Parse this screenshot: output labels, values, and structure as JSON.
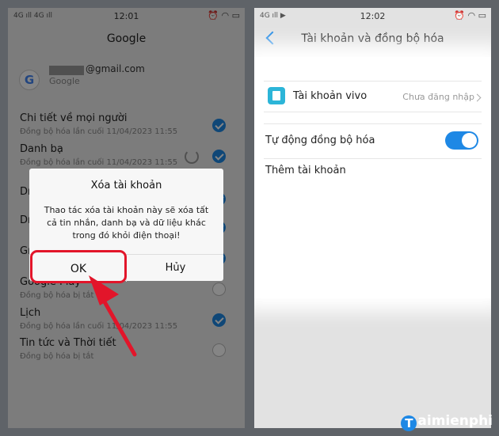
{
  "left": {
    "status": {
      "left": "4G ıll 4G ıll",
      "time": "12:01",
      "right": "⏰ ◠ ▭"
    },
    "title": "Google",
    "account": {
      "email_suffix": "@gmail.com",
      "provider": "Google"
    },
    "items": [
      {
        "title": "Chi tiết về mọi người",
        "sub": "Đồng bộ hóa lần cuối 11/04/2023 11:55",
        "checked": true
      },
      {
        "title": "Danh bạ",
        "sub": "Đồng bộ hóa lần cuối 11/04/2023 11:55",
        "checked": true
      },
      {
        "title": "Dr",
        "sub": "",
        "checked": true
      },
      {
        "title": "Dr",
        "sub": "",
        "checked": true
      },
      {
        "title": "Gr",
        "sub": "",
        "checked": true
      },
      {
        "title": "Google Play",
        "sub": "Đồng bộ hóa bị tắt",
        "checked": false
      },
      {
        "title": "Lịch",
        "sub": "Đồng bộ hóa lần cuối 11/04/2023 11:55",
        "checked": true
      },
      {
        "title": "Tin tức và Thời tiết",
        "sub": "Đồng bộ hóa bị tắt",
        "checked": false
      }
    ],
    "dialog": {
      "title": "Xóa tài khoản",
      "message": "Thao tác xóa tài khoản này sẽ xóa tất cả tin nhắn, danh bạ và dữ liệu khác trong đó khỏi điện thoại!",
      "ok": "OK",
      "cancel": "Hủy"
    }
  },
  "right": {
    "status": {
      "left": "4G ıll ▶",
      "time": "12:02",
      "right": "⏰ ◠ ▭"
    },
    "title": "Tài khoản và đồng bộ hóa",
    "vivo_label": "Tài khoản vivo",
    "vivo_status": "Chưa đăng nhập",
    "autosync_label": "Tự động đồng bộ hóa",
    "autosync_on": true,
    "add_account_label": "Thêm tài khoản"
  },
  "watermark": {
    "logo": "T",
    "text": "aimienphi"
  },
  "colors": {
    "accent": "#1e88e5",
    "highlight": "#e2152a"
  }
}
